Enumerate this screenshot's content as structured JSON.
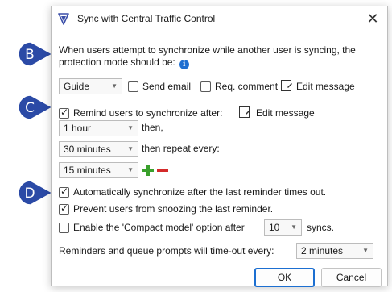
{
  "dialog": {
    "title": "Sync with Central Traffic Control",
    "close_glyph": "✕",
    "intro_line1": "When users attempt to synchronize while another user is syncing, the",
    "intro_line2": "protection mode should be:",
    "info_glyph": "i"
  },
  "protection": {
    "mode_value": "Guide",
    "send_email_label": "Send email",
    "send_email_checked": false,
    "req_comment_label": "Req. comment",
    "req_comment_checked": false,
    "edit_message_label": "Edit message"
  },
  "remind": {
    "checked": true,
    "label": "Remind users to synchronize after:",
    "edit_message_label": "Edit message",
    "first_value": "1 hour",
    "first_suffix": "then,",
    "second_value": "30 minutes",
    "second_suffix": "then repeat every:",
    "third_value": "15 minutes"
  },
  "auto_sync": {
    "checked": true,
    "label": "Automatically synchronize after the last reminder times out."
  },
  "prevent_snooze": {
    "checked": true,
    "label": "Prevent users from snoozing the last reminder."
  },
  "compact": {
    "checked": false,
    "label": "Enable the 'Compact model' option after",
    "value": "10",
    "suffix": "syncs."
  },
  "timeout": {
    "label": "Reminders and queue prompts will time-out every:",
    "value": "2 minutes"
  },
  "buttons": {
    "ok": "OK",
    "cancel": "Cancel"
  },
  "callouts": [
    "B",
    "C",
    "D"
  ],
  "colors": {
    "callout_fill": "#2b4aa6",
    "accent": "#1f6fd1",
    "plus": "#3aa02c",
    "minus": "#d42a2a"
  },
  "icons": {
    "app": "sync-shield-icon",
    "chevron": "chevron-down-icon",
    "edit": "edit-message-icon",
    "plus": "plus-icon",
    "minus": "minus-icon",
    "info": "info-icon"
  }
}
